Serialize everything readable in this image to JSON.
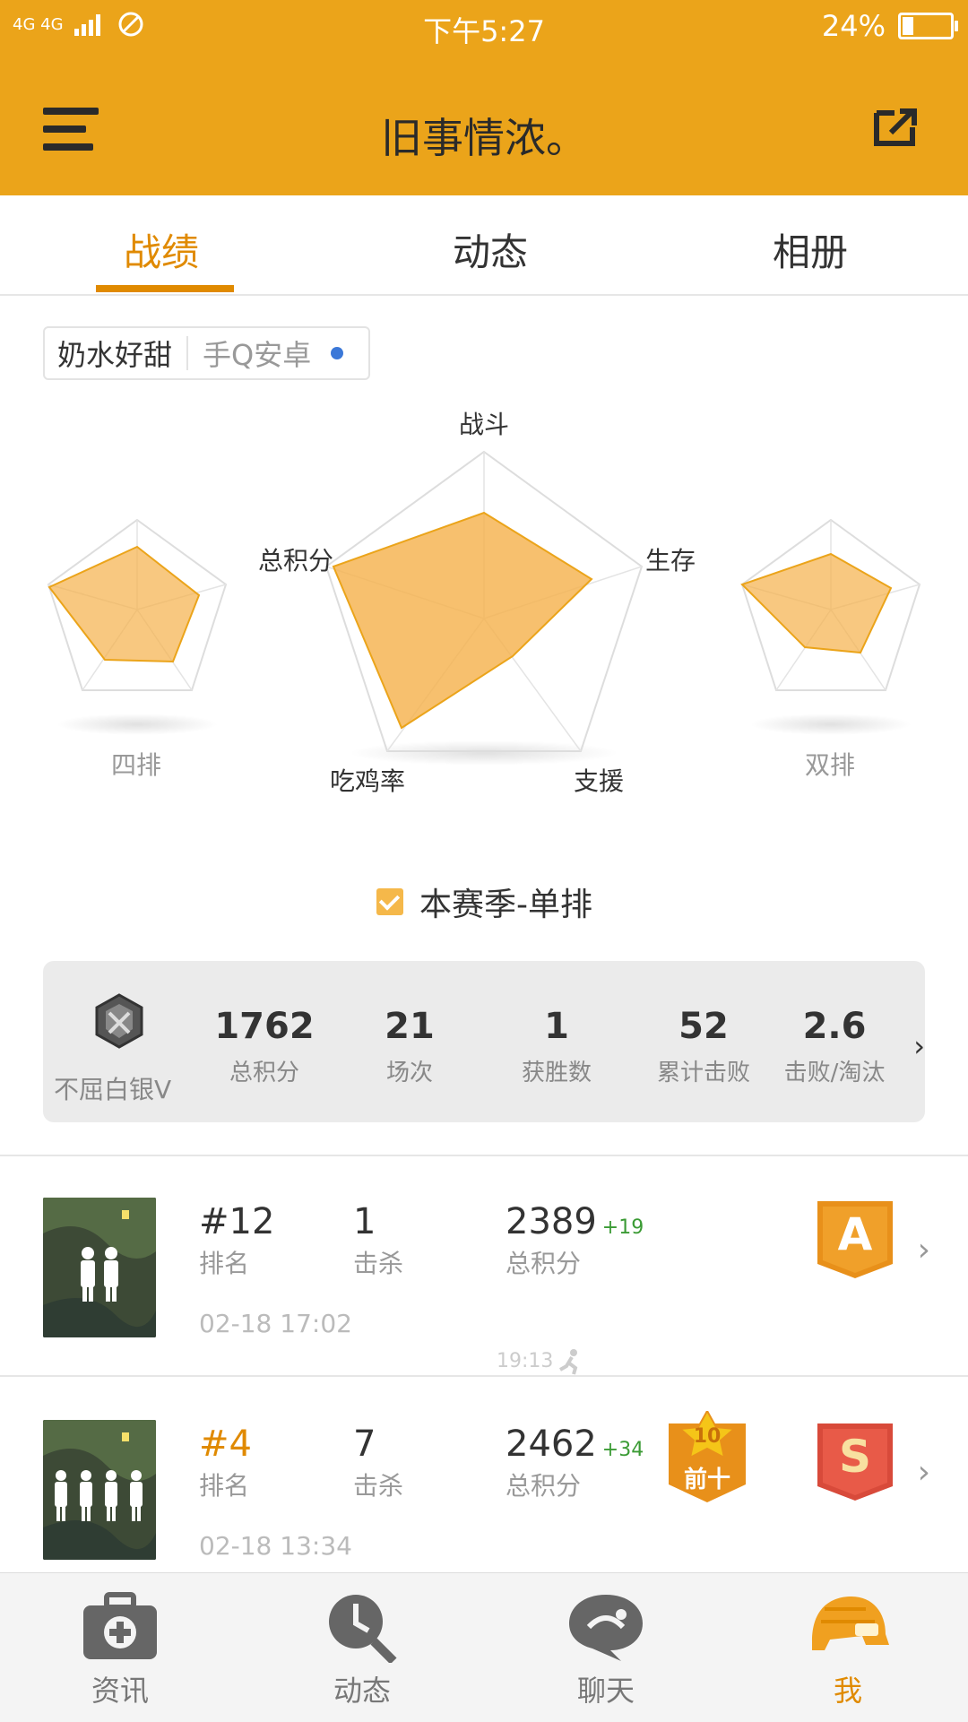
{
  "status_bar": {
    "network": "4G 4G",
    "time": "下午5:27",
    "battery": "24%",
    "battery_level": 0.24
  },
  "app_bar": {
    "title": "旧事情浓。"
  },
  "tabs": [
    {
      "label": "战绩",
      "active": true
    },
    {
      "label": "动态"
    },
    {
      "label": "相册"
    }
  ],
  "account": {
    "name": "奶水好甜",
    "platform": "手Q安卓"
  },
  "radar": {
    "axes": [
      "战斗",
      "生存",
      "支援",
      "吃鸡率",
      "总积分"
    ],
    "left_label": "四排",
    "right_label": "双排"
  },
  "season": {
    "label": "本赛季-单排",
    "checked": true
  },
  "stats": {
    "rank_name": "不屈白银V",
    "items": [
      {
        "value": "1762",
        "label": "总积分"
      },
      {
        "value": "21",
        "label": "场次"
      },
      {
        "value": "1",
        "label": "获胜数"
      },
      {
        "value": "52",
        "label": "累计击败"
      },
      {
        "value": "2.6",
        "label": "击败/淘汰"
      }
    ]
  },
  "matches": [
    {
      "rank": "#12",
      "rank_label": "排名",
      "kills": "1",
      "kills_label": "击杀",
      "score": "2389",
      "score_delta": "+19",
      "score_label": "总积分",
      "date": "02-18 17:02",
      "grade": "A",
      "timestamp": "19:13"
    },
    {
      "rank": "#4",
      "rank_label": "排名",
      "kills": "7",
      "kills_label": "击杀",
      "score": "2462",
      "score_delta": "+34",
      "score_label": "总积分",
      "date": "02-18 13:34",
      "badge_top": "10",
      "badge_bottom": "前十",
      "grade": "S"
    }
  ],
  "nav": [
    {
      "label": "资讯",
      "icon": "first-aid-kit-icon"
    },
    {
      "label": "动态",
      "icon": "pan-clock-icon"
    },
    {
      "label": "聊天",
      "icon": "chat-bubble-icon"
    },
    {
      "label": "我",
      "icon": "helmet-icon",
      "active": true
    }
  ],
  "colors": {
    "accent": "#e08a00",
    "header": "#eba41a",
    "radar_fill": "#f5b04a"
  }
}
